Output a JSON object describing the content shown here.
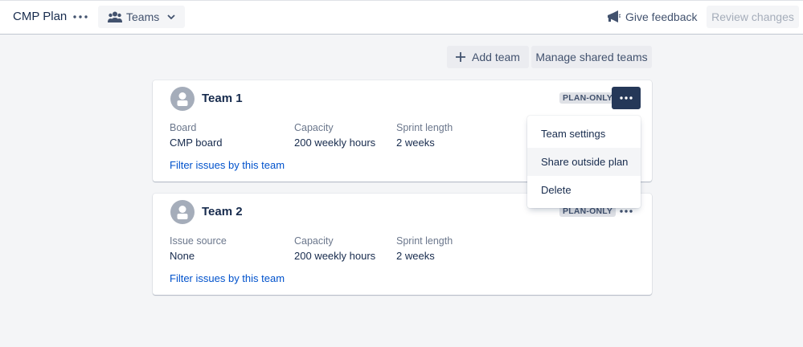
{
  "header": {
    "plan_title": "CMP Plan",
    "teams_label": "Teams",
    "feedback_label": "Give feedback",
    "review_label": "Review changes"
  },
  "actions": {
    "add_team": "Add team",
    "manage_shared": "Manage shared teams"
  },
  "teams": [
    {
      "name": "Team 1",
      "lozenge": "PLAN-ONLY",
      "fields": [
        {
          "label": "Board",
          "value": "CMP board"
        },
        {
          "label": "Capacity",
          "value": "200 weekly hours"
        },
        {
          "label": "Sprint length",
          "value": "2 weeks"
        }
      ],
      "filter_link": "Filter issues by this team",
      "menu_open": true
    },
    {
      "name": "Team 2",
      "lozenge": "PLAN-ONLY",
      "fields": [
        {
          "label": "Issue source",
          "value": "None"
        },
        {
          "label": "Capacity",
          "value": "200 weekly hours"
        },
        {
          "label": "Sprint length",
          "value": "2 weeks"
        }
      ],
      "filter_link": "Filter issues by this team",
      "menu_open": false
    }
  ],
  "team_menu": {
    "items": [
      "Team settings",
      "Share outside plan",
      "Delete"
    ],
    "highlighted_item": "Share outside plan"
  },
  "icons": {
    "more": "more-horizontal-icon",
    "teams": "people-group-icon",
    "chevron": "chevron-down-icon",
    "feedback": "megaphone-icon",
    "add": "plus-icon",
    "avatar": "team-avatar-icon"
  },
  "colors": {
    "accent_link": "#0052cc",
    "active_more_button": "#253858",
    "background": "#f4f5f7"
  }
}
